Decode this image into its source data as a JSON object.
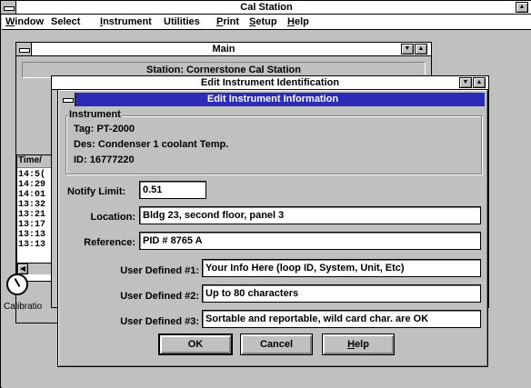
{
  "app": {
    "title": "Cal Station",
    "menu": [
      "Window",
      "Select",
      "Instrument",
      "Utilities",
      "Print",
      "Setup",
      "Help"
    ]
  },
  "main_window": {
    "title": "Main",
    "station_label": "Station: Cornerstone Cal Station"
  },
  "list_window": {
    "header": "Time/",
    "times": [
      "14:5(",
      "14:29",
      "14:01",
      "13:32",
      "13:21",
      "13:17",
      "13:13",
      "13:13"
    ]
  },
  "ident_window": {
    "title": "Edit Instrument Identification"
  },
  "desktop_icon": {
    "label": "Calibratio",
    "icon": "gauge-icon"
  },
  "dialog": {
    "title": "Edit Instrument Information",
    "instrument_group": {
      "legend": "Instrument",
      "tag": "Tag:  PT-2000",
      "des": "Des:  Condenser 1 coolant Temp.",
      "id": "ID:    16777220"
    },
    "fields": {
      "notify_limit": {
        "label": "Notify Limit:",
        "value": "0.51"
      },
      "location": {
        "label": "Location:",
        "value": "Bldg 23, second floor, panel 3"
      },
      "reference": {
        "label": "Reference:",
        "value": "PID # 8765 A"
      },
      "user1": {
        "label": "User Defined #1:",
        "value": "Your Info Here (loop ID, System, Unit, Etc)"
      },
      "user2": {
        "label": "User Defined #2:",
        "value": "Up to 80 characters"
      },
      "user3": {
        "label": "User Defined #3:",
        "value": "Sortable and reportable, wild card char. are OK"
      }
    },
    "buttons": {
      "ok": "OK",
      "cancel": "Cancel",
      "help": "Help"
    }
  },
  "colors": {
    "active_title": "#2b2bb7",
    "face": "#c0c0c0"
  }
}
